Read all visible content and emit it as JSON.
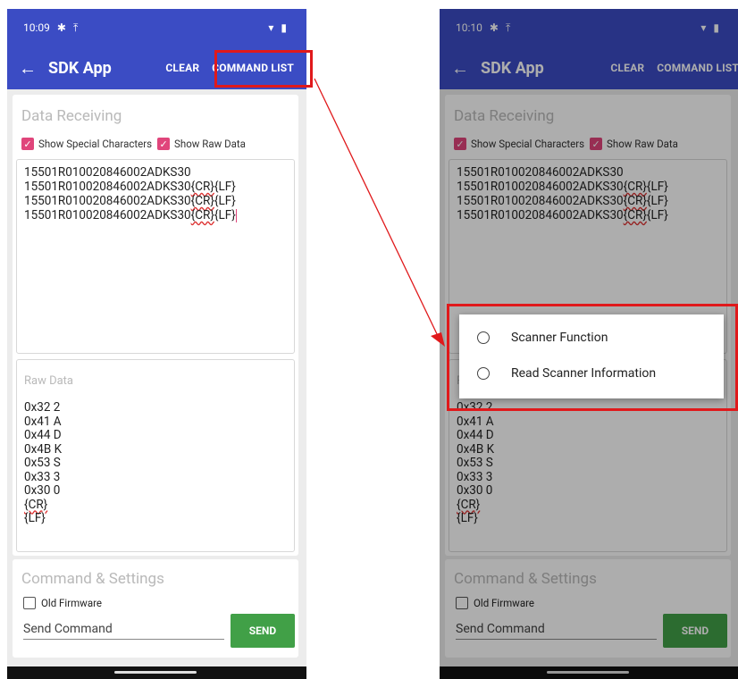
{
  "left": {
    "status": {
      "time": "10:09",
      "bt_icon": "bluetooth-icon",
      "upload_icon": "upload-icon"
    },
    "appbar": {
      "title": "SDK App",
      "clear": "CLEAR",
      "command_list": "COMMAND LIST"
    },
    "receiving": {
      "title": "Data Receiving",
      "show_special": "Show Special Characters",
      "show_raw": "Show Raw Data",
      "lines": [
        {
          "text": "15501R010020846002ADKS30",
          "cr": "",
          "lf": ""
        },
        {
          "text": "15501R010020846002ADKS30",
          "cr": "{CR}",
          "lf": "{LF}"
        },
        {
          "text": "15501R010020846002ADKS30",
          "cr": "{CR}",
          "lf": "{LF}"
        },
        {
          "text": "15501R010020846002ADKS30",
          "cr": "{CR}",
          "lf": "{LF}"
        }
      ]
    },
    "raw": {
      "title": "Raw Data",
      "lines": [
        "0x32 2",
        "0x41 A",
        "0x44 D",
        "0x4B K",
        "0x53 S",
        "0x33 3",
        "0x30 0",
        "{CR}",
        "{LF}"
      ]
    },
    "command": {
      "title": "Command & Settings",
      "old_firmware": "Old Firmware",
      "send_placeholder": "Send Command",
      "send": "SEND"
    }
  },
  "right": {
    "status": {
      "time": "10:10",
      "bt_icon": "bluetooth-icon",
      "upload_icon": "upload-icon"
    },
    "appbar": {
      "title": "SDK App",
      "clear": "CLEAR",
      "command_list": "COMMAND LIST"
    },
    "receiving": {
      "title": "Data Receiving",
      "show_special": "Show Special Characters",
      "show_raw": "Show Raw Data",
      "lines": [
        {
          "text": "15501R010020846002ADKS30",
          "cr": "",
          "lf": ""
        },
        {
          "text": "15501R010020846002ADKS30",
          "cr": "{CR}",
          "lf": "{LF}"
        },
        {
          "text": "15501R010020846002ADKS30",
          "cr": "{CR}",
          "lf": "{LF}"
        },
        {
          "text": "15501R010020846002ADKS30",
          "cr": "{CR}",
          "lf": "{LF}"
        }
      ]
    },
    "raw": {
      "title": "R",
      "lines": [
        "0x32 2",
        "0x41 A",
        "0x44 D",
        "0x4B K",
        "0x53 S",
        "0x33 3",
        "0x30 0",
        "{CR}",
        "{LF}"
      ]
    },
    "command": {
      "title": "Command & Settings",
      "old_firmware": "Old Firmware",
      "send_placeholder": "Send Command",
      "send": "SEND"
    },
    "dialog": {
      "options": [
        "Scanner Function",
        "Read Scanner Information"
      ]
    }
  },
  "colors": {
    "appbar": "#3b4cc4",
    "checkbox": "#e0457b",
    "send": "#41a047",
    "highlight": "#e0191b"
  }
}
